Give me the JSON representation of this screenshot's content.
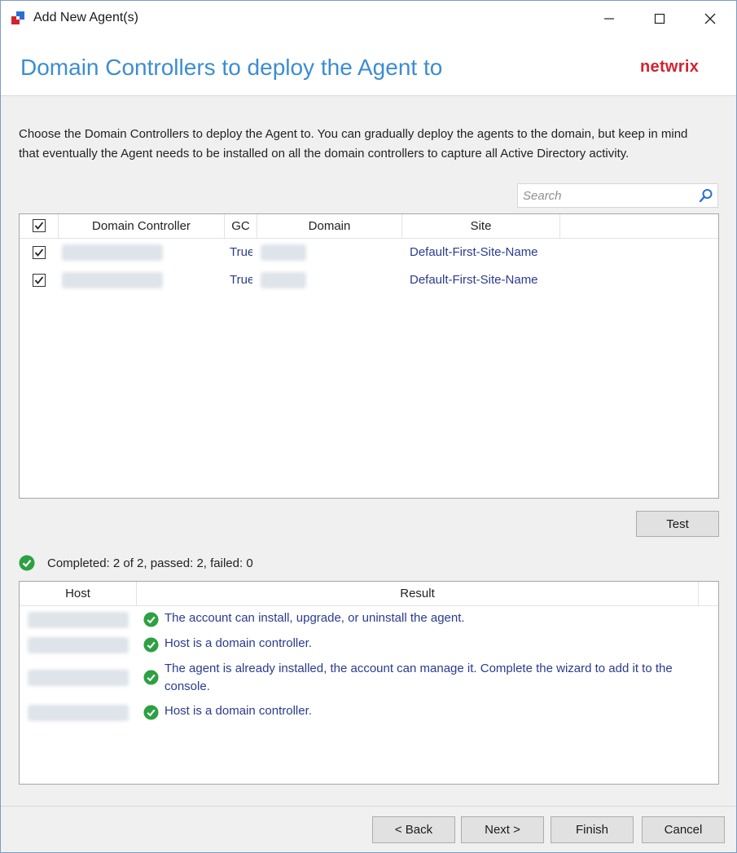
{
  "window": {
    "title": "Add New Agent(s)",
    "controls": {
      "minimize": "minimize-icon",
      "maximize": "maximize-icon",
      "close": "close-icon"
    }
  },
  "header": {
    "title": "Domain Controllers to deploy the Agent to",
    "brand": "netwrix",
    "brand_color": "#d3232f",
    "title_color": "#3c8dd0"
  },
  "description": "Choose the Domain Controllers to deploy the Agent to. You can gradually deploy the agents to the domain, but keep in mind that eventually the Agent needs to be installed on all the domain controllers to capture all Active Directory activity.",
  "search": {
    "placeholder": "Search",
    "value": ""
  },
  "dc_table": {
    "select_all_checked": true,
    "columns": [
      "Domain Controller",
      "GC",
      "Domain",
      "Site"
    ],
    "rows": [
      {
        "checked": true,
        "domain_controller": "",
        "gc": "True",
        "domain": "",
        "site": "Default-First-Site-Name"
      },
      {
        "checked": true,
        "domain_controller": "",
        "gc": "True",
        "domain": "",
        "site": "Default-First-Site-Name"
      }
    ]
  },
  "test_button": "Test",
  "status": {
    "text": "Completed: 2 of 2, passed: 2, failed: 0",
    "color": "#2ea043"
  },
  "results_table": {
    "columns": [
      "Host",
      "Result"
    ],
    "rows": [
      {
        "host": "",
        "result": "The account can install, upgrade, or uninstall the agent."
      },
      {
        "host": "",
        "result": "Host is a domain controller."
      },
      {
        "host": "",
        "result": "The agent is already installed, the account can manage it. Complete the wizard to add it to the console."
      },
      {
        "host": "",
        "result": "Host is a domain controller."
      }
    ]
  },
  "footer": {
    "back": "< Back",
    "next": "Next >",
    "finish": "Finish",
    "cancel": "Cancel"
  }
}
